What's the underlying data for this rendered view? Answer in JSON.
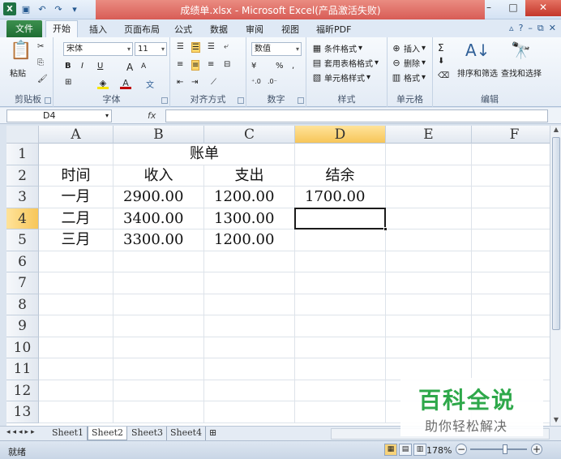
{
  "window": {
    "title": "成绩单.xlsx - Microsoft Excel(产品激活失败)",
    "minimize": "–",
    "maximize": "□",
    "close": "✕"
  },
  "ribbon_tabs": {
    "file": "文件",
    "tabs": [
      "开始",
      "插入",
      "页面布局",
      "公式",
      "数据",
      "审阅",
      "视图",
      "福昕PDF"
    ],
    "active": "开始"
  },
  "clipboard": {
    "paste": "粘贴",
    "label": "剪贴板"
  },
  "font": {
    "name": "宋体",
    "size": "11",
    "bold": "B",
    "italic": "I",
    "underline": "U",
    "grow": "A",
    "shrink": "A",
    "wen": "文",
    "label": "字体",
    "fill_color": "#f7e400",
    "font_color": "#c00000"
  },
  "alignment": {
    "label": "对齐方式"
  },
  "number": {
    "format": "数值",
    "percent": "%",
    "comma": ",",
    "label": "数字"
  },
  "styles": {
    "conditional": "条件格式",
    "table": "套用表格格式",
    "cell": "单元格样式",
    "label": "样式"
  },
  "cells_group": {
    "insert": "插入",
    "delete": "删除",
    "format": "格式",
    "label": "单元格"
  },
  "editing": {
    "sigma": "Σ",
    "sort": "排序和筛选",
    "find": "查找和选择",
    "label": "编辑"
  },
  "formula_bar": {
    "name_box": "D4",
    "fx": "fx",
    "value": ""
  },
  "grid": {
    "columns": [
      "A",
      "B",
      "C",
      "D",
      "E",
      "F"
    ],
    "rows": [
      "1",
      "2",
      "3",
      "4",
      "5",
      "6",
      "7",
      "8",
      "9",
      "10",
      "11",
      "12",
      "13"
    ],
    "selected_column": "D",
    "selected_row": "4",
    "title": "账单",
    "headers": [
      "时间",
      "收入",
      "支出",
      "结余"
    ],
    "data": [
      [
        "一月",
        "2900.00",
        "1200.00",
        "1700.00"
      ],
      [
        "二月",
        "3400.00",
        "1300.00",
        ""
      ],
      [
        "三月",
        "3300.00",
        "1200.00",
        ""
      ]
    ]
  },
  "sheet_tabs": {
    "tabs": [
      "Sheet1",
      "Sheet2",
      "Sheet3",
      "Sheet4"
    ],
    "active": "Sheet2"
  },
  "status": {
    "ready": "就绪",
    "zoom": "178%",
    "zoom_value_percent": 178
  },
  "watermark": {
    "title": "百科全说",
    "subtitle": "助你轻松解决"
  }
}
